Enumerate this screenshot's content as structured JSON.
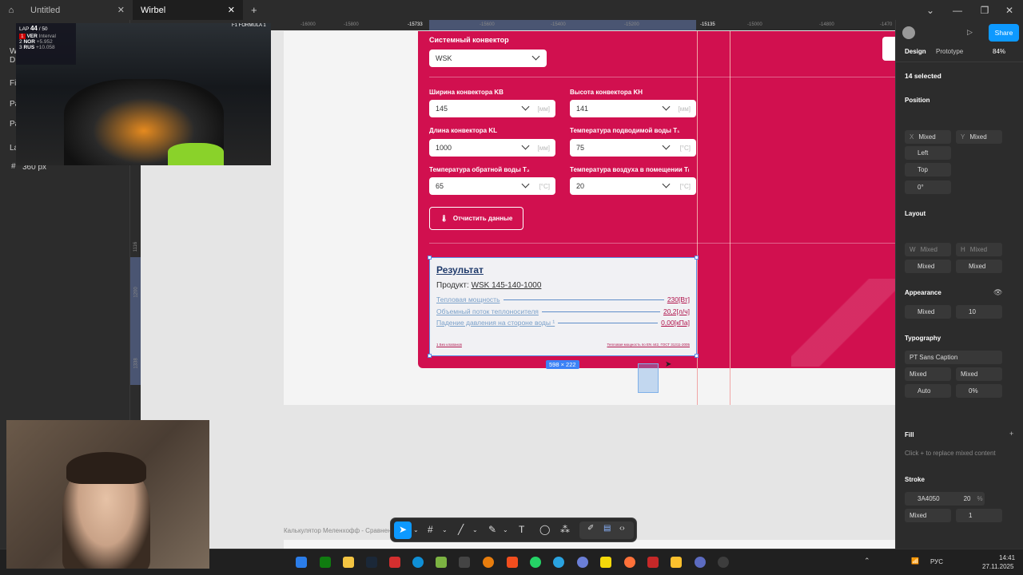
{
  "tabs": [
    {
      "label": "Untitled",
      "active": false
    },
    {
      "label": "Wirbel",
      "active": true
    }
  ],
  "ruler": {
    "top_labels": [
      "-16000",
      "-15800",
      "-15733",
      "-15600",
      "-15400",
      "-15200",
      "-15135",
      "-15000",
      "-14800",
      "-1470"
    ],
    "left_labels": [
      "1116",
      "1200",
      "1338"
    ]
  },
  "left_panel": {
    "items": [
      "W",
      "D",
      "Fi",
      "Pa",
      "Pa",
      "La",
      "360 px"
    ]
  },
  "f1_overlay": {
    "lap_label": "LAP",
    "lap_current": "44",
    "lap_total": "/ 50",
    "series_logo": "F1 FORMULA 1",
    "drivers": [
      {
        "pos": "1",
        "code": "VER",
        "gap": "Interval"
      },
      {
        "pos": "2",
        "code": "NOR",
        "gap": "+5.952"
      },
      {
        "pos": "3",
        "code": "RUS",
        "gap": "+10.058"
      }
    ]
  },
  "calculator": {
    "system_label": "Системный конвектор",
    "system_value": "WSK",
    "fields": [
      {
        "label": "Ширина конвектора KB",
        "value": "145",
        "unit": "[мм]"
      },
      {
        "label": "Высота конвектора KH",
        "value": "141",
        "unit": "[мм]"
      },
      {
        "label": "Длина конвектора KL",
        "value": "1000",
        "unit": "[мм]"
      },
      {
        "label": "Температура подводимой воды T₁",
        "value": "75",
        "unit": "[°C]"
      },
      {
        "label": "Температура обратной воды T₂",
        "value": "65",
        "unit": "[°C]"
      },
      {
        "label": "Температура воздуха в помещении Tₗ",
        "value": "20",
        "unit": "[°C]"
      }
    ],
    "clear_button": "Отчистить данные"
  },
  "result": {
    "title": "Результат",
    "product_prefix": "Продукт:",
    "product": "WSK 145-140-1000",
    "rows": [
      {
        "label": "Тепловая мощность",
        "value": "230[Вт]"
      },
      {
        "label": "Объемный поток теплоносителя",
        "value": "20,2[л/ч]"
      },
      {
        "label": "Падение давления на стороне воды ¹",
        "value": "0,00[кПа]"
      }
    ],
    "foot_left": "1 Без клапанов",
    "foot_right": "Тепловая мощность по EN 442, ГОСТ 31311-2005",
    "dimensions": "598 × 222"
  },
  "canvas_caption": "Калькулятор Меленхофф - Сравнени",
  "right_panel": {
    "share_label": "Share",
    "tabs": [
      "Design",
      "Prototype"
    ],
    "zoom": "84%",
    "selected": "14 selected",
    "position": {
      "title": "Position",
      "x_label": "X",
      "x": "Mixed",
      "y_label": "Y",
      "y": "Mixed",
      "h_constraint": "Left",
      "v_constraint": "Top",
      "rotation": "0°"
    },
    "layout": {
      "title": "Layout",
      "w_label": "W",
      "w": "Mixed",
      "h_label": "H",
      "h": "Mixed",
      "mw": "Mixed",
      "mh": "Mixed"
    },
    "appearance": {
      "title": "Appearance",
      "opacity": "Mixed",
      "radius": "10"
    },
    "typography": {
      "title": "Typography",
      "font": "PT Sans Caption",
      "weight": "Mixed",
      "size": "Mixed",
      "line_height": "Auto",
      "letter_spacing": "0%"
    },
    "fill": {
      "title": "Fill",
      "hint": "Click + to replace mixed content"
    },
    "stroke": {
      "title": "Stroke",
      "color": "3A4050",
      "opacity": "20",
      "percent": "%",
      "position": "Mixed",
      "weight": "1"
    }
  },
  "taskbar": {
    "lang": "РУС",
    "time": "14:41",
    "date": "27.11.2025"
  },
  "colors": {
    "accent_pink": "#d1104f",
    "selection_blue": "#3b82f6",
    "share_blue": "#0d99ff"
  }
}
